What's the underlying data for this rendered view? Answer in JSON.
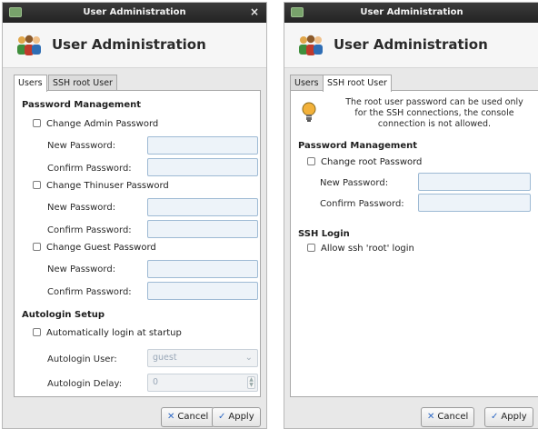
{
  "window": {
    "title": "User Administration",
    "close_glyph": "×",
    "header_title": "User Administration",
    "icon": "users-group-icon"
  },
  "tabs": {
    "users_label": "Users",
    "ssh_root_label": "SSH root User"
  },
  "left_window": {
    "active_tab": "Users",
    "password_management": {
      "heading": "Password Management",
      "admin": {
        "checkbox_label": "Change Admin Password",
        "checked": false
      },
      "thinuser": {
        "checkbox_label": "Change Thinuser Password",
        "checked": false
      },
      "guest": {
        "checkbox_label": "Change Guest Password",
        "checked": false
      },
      "new_password_label": "New Password:",
      "confirm_password_label": "Confirm Password:"
    },
    "autologin": {
      "heading": "Autologin Setup",
      "checkbox_label": "Automatically login at startup",
      "checked": false,
      "user_label": "Autologin User:",
      "user_value": "guest",
      "delay_label": "Autologin Delay:",
      "delay_value": "0"
    }
  },
  "right_window": {
    "active_tab": "SSH root User",
    "info_line1": "The root user password can be used only",
    "info_line2": "for the SSH connections, the console",
    "info_line3": "connection is not allowed.",
    "password_management": {
      "heading": "Password Management",
      "checkbox_label": "Change root Password",
      "checked": false,
      "new_password_label": "New Password:",
      "confirm_password_label": "Confirm Password:"
    },
    "ssh_login": {
      "heading": "SSH Login",
      "checkbox_label": "Allow ssh 'root' login",
      "checked": false
    }
  },
  "buttons": {
    "cancel_label": "Cancel",
    "apply_label": "Apply"
  },
  "colors": {
    "titlebar": "#2b2b2b",
    "field_border": "#9ebad4",
    "field_bg": "#edf3f9",
    "button_icon": "#2d68c4"
  }
}
